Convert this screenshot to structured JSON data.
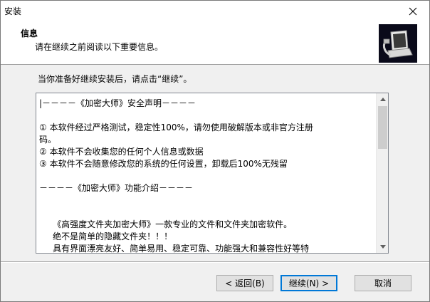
{
  "window": {
    "title": "安装"
  },
  "header": {
    "title": "信息",
    "subtitle": "请在继续之前阅读以下重要信息。"
  },
  "instruction": "当你准备好继续安装后，请点击“继续”。",
  "license_text": {
    "lines": [
      "|－－－－《加密大师》安全声明－－－－",
      "",
      "① 本软件经过严格测试，稳定性100%，请勿使用破解版本或非官方注册",
      "码。",
      "② 本软件不会收集您的任何个人信息或数据",
      "③ 本软件不会随意修改您的系统的任何设置，卸载后100%无残留",
      "",
      "－－－－《加密大师》功能介绍－－－－",
      "",
      "",
      "     《高强度文件夹加密大师》一款专业的文件和文件夹加密软件。",
      "     绝不是简单的隐藏文件夹！！！",
      "     具有界面漂亮友好、简单易用、稳定可靠、功能强大和兼容性好等特"
    ]
  },
  "buttons": {
    "back": "< 返回(B)",
    "next": "继续(N) >",
    "cancel": "取消"
  },
  "icons": {
    "close": "close-icon",
    "logo": "installer-computer-icon"
  }
}
